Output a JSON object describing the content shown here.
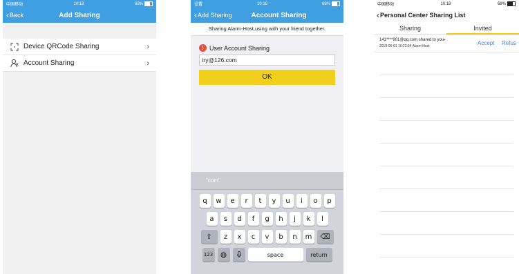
{
  "phone1": {
    "status": {
      "left": "中国移动",
      "time": "10:18",
      "right": "68%"
    },
    "nav": {
      "back": "Back",
      "title": "Add Sharing"
    },
    "items": [
      {
        "label": "Device QRCode Sharing",
        "icon": "qrcode-scan-icon"
      },
      {
        "label": "Account Sharing",
        "icon": "user-share-icon"
      }
    ]
  },
  "phone2": {
    "status": {
      "left": "设置",
      "time": "10:18",
      "right": "68%"
    },
    "nav": {
      "back": "Add Sharing",
      "title": "Account Sharing"
    },
    "info": "Sharing Alarm-Host,using with your friend together.",
    "label": "User Account Sharing",
    "input_value": "try@126.com",
    "ok": "OK",
    "keyboard": {
      "suggestion": "\"com\"",
      "row1": [
        "q",
        "w",
        "e",
        "r",
        "t",
        "y",
        "u",
        "i",
        "o",
        "p"
      ],
      "row2": [
        "a",
        "s",
        "d",
        "f",
        "g",
        "h",
        "j",
        "k",
        "l"
      ],
      "row3": [
        "z",
        "x",
        "c",
        "v",
        "b",
        "n",
        "m"
      ],
      "numbers": "123",
      "space": "space",
      "return": "return"
    }
  },
  "phone3": {
    "status": {
      "left": "中国移动",
      "time": "10:18",
      "right": "68%"
    },
    "nav": {
      "title": "Personal Center Sharing List"
    },
    "tabs": [
      "Sharing",
      "Invited"
    ],
    "share": {
      "message": "141****901@qq.com shared to you",
      "time": "2018-06-01 16:22:54",
      "device": "Alarm-Host",
      "accept": "Accept",
      "refuse": "Refus"
    }
  }
}
